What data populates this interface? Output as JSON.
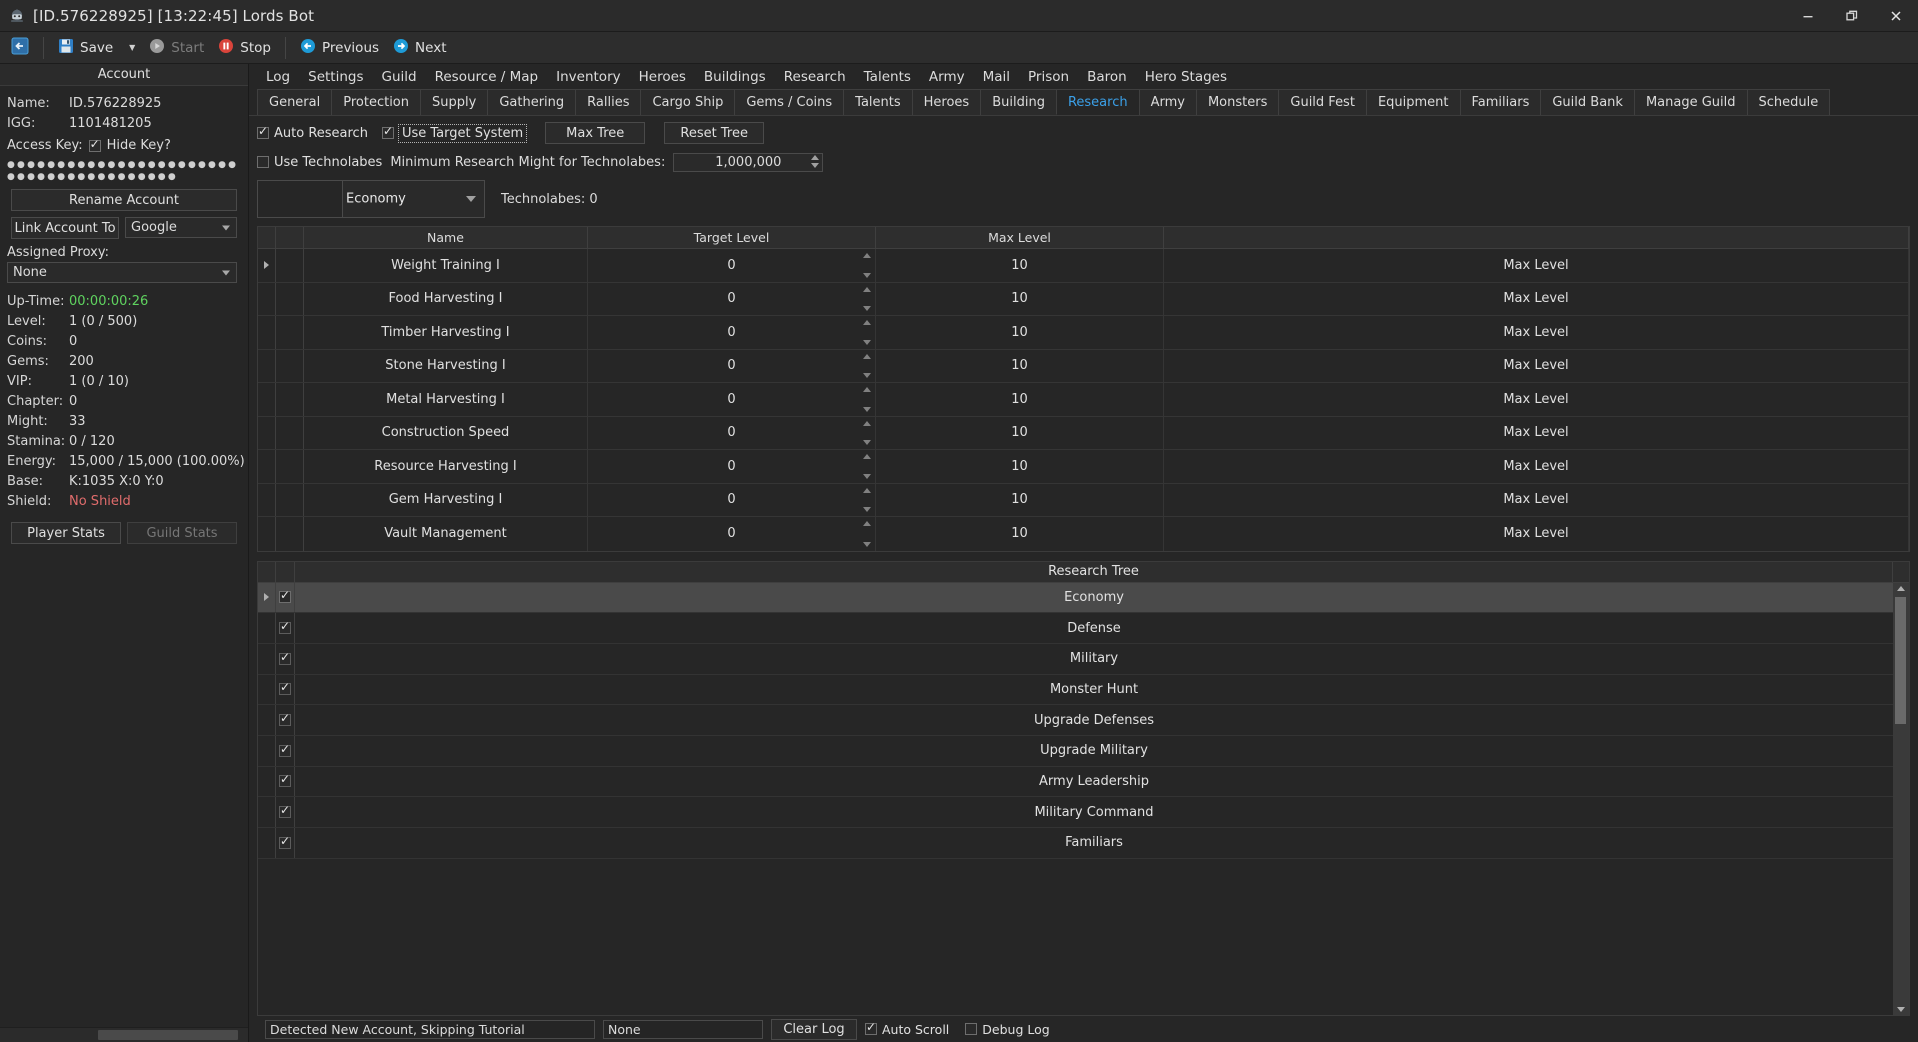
{
  "window": {
    "title": "[ID.576228925] [13:22:45] Lords Bot",
    "app_icon": "bot-icon",
    "minimize": "—",
    "maximize": "❐",
    "close": "✕"
  },
  "toolbar": {
    "back_icon": "back-arrow-icon",
    "save_label": "Save",
    "save_icon": "floppy-disk-icon",
    "save_caret": "▼",
    "start_label": "Start",
    "start_icon": "play-icon",
    "stop_label": "Stop",
    "stop_icon": "pause-icon",
    "previous_label": "Previous",
    "previous_icon": "left-arrow-icon",
    "next_label": "Next",
    "next_icon": "right-arrow-icon"
  },
  "sidebar": {
    "header": "Account",
    "name_label": "Name:",
    "name_value": "ID.576228925",
    "igg_label": "IGG:",
    "igg_value": "1101481205",
    "access_key_label": "Access Key:",
    "hide_key_label": "Hide Key?",
    "hide_key_checked": true,
    "masked_key": "●●●●●●●●●●●●●●●●●●●●●●●●●●●●●●●●●●●●●●●●",
    "rename_account_label": "Rename Account",
    "link_account_label": "Link Account To",
    "link_provider": "Google",
    "assigned_proxy_label": "Assigned Proxy:",
    "assigned_proxy_value": "None",
    "stats": [
      {
        "label": "Up-Time:",
        "value": "00:00:00:26",
        "color": "green"
      },
      {
        "label": "Level:",
        "value": "1  (0 / 500)",
        "color": ""
      },
      {
        "label": "Coins:",
        "value": "0",
        "color": ""
      },
      {
        "label": "Gems:",
        "value": "200",
        "color": ""
      },
      {
        "label": "VIP:",
        "value": "1  (0 / 10)",
        "color": ""
      },
      {
        "label": "Chapter:",
        "value": "0",
        "color": ""
      },
      {
        "label": "Might:",
        "value": "33",
        "color": ""
      },
      {
        "label": "Stamina:",
        "value": "0 / 120",
        "color": ""
      },
      {
        "label": "Energy:",
        "value": "15,000 / 15,000 (100.00%)",
        "color": ""
      },
      {
        "label": "Base:",
        "value": "K:1035 X:0 Y:0",
        "color": ""
      },
      {
        "label": "Shield:",
        "value": "No Shield",
        "color": "red"
      }
    ],
    "player_stats_label": "Player Stats",
    "guild_stats_label": "Guild Stats"
  },
  "menubar": {
    "items": [
      "Log",
      "Settings",
      "Guild",
      "Resource / Map",
      "Inventory",
      "Heroes",
      "Buildings",
      "Research",
      "Talents",
      "Army",
      "Mail",
      "Prison",
      "Baron",
      "Hero Stages"
    ]
  },
  "tabs": {
    "active": "Research",
    "items": [
      "General",
      "Protection",
      "Supply",
      "Gathering",
      "Rallies",
      "Cargo Ship",
      "Gems / Coins",
      "Talents",
      "Heroes",
      "Building",
      "Research",
      "Army",
      "Monsters",
      "Guild Fest",
      "Equipment",
      "Familiars",
      "Guild Bank",
      "Manage Guild",
      "Schedule"
    ]
  },
  "research_panel": {
    "auto_research_label": "Auto Research",
    "auto_research_checked": true,
    "use_target_system_label": "Use Target System",
    "use_target_system_checked": true,
    "max_tree_label": "Max Tree",
    "reset_tree_label": "Reset Tree",
    "use_technolabes_label": "Use Technolabes",
    "use_technolabes_checked": false,
    "min_might_label": "Minimum Research Might for Technolabes:",
    "min_might_value": "1,000,000",
    "category_value": "Economy",
    "technolabes_count_label": "Technolabes: 0"
  },
  "grid": {
    "headers": [
      "",
      "",
      "Name",
      "Target Level",
      "Max Level",
      ""
    ],
    "rows": [
      {
        "name": "Weight Training I",
        "target": "0",
        "max": "10",
        "status": "Max Level"
      },
      {
        "name": "Food Harvesting I",
        "target": "0",
        "max": "10",
        "status": "Max Level"
      },
      {
        "name": "Timber Harvesting I",
        "target": "0",
        "max": "10",
        "status": "Max Level"
      },
      {
        "name": "Stone Harvesting I",
        "target": "0",
        "max": "10",
        "status": "Max Level"
      },
      {
        "name": "Metal Harvesting I",
        "target": "0",
        "max": "10",
        "status": "Max Level"
      },
      {
        "name": "Construction Speed",
        "target": "0",
        "max": "10",
        "status": "Max Level"
      },
      {
        "name": "Resource Harvesting I",
        "target": "0",
        "max": "10",
        "status": "Max Level"
      },
      {
        "name": "Gem Harvesting I",
        "target": "0",
        "max": "10",
        "status": "Max Level"
      },
      {
        "name": "Vault Management",
        "target": "0",
        "max": "10",
        "status": "Max Level"
      }
    ]
  },
  "tree": {
    "header": "Research Tree",
    "rows": [
      {
        "name": "Economy",
        "checked": true,
        "selected": true
      },
      {
        "name": "Defense",
        "checked": true,
        "selected": false
      },
      {
        "name": "Military",
        "checked": true,
        "selected": false
      },
      {
        "name": "Monster Hunt",
        "checked": true,
        "selected": false
      },
      {
        "name": "Upgrade Defenses",
        "checked": true,
        "selected": false
      },
      {
        "name": "Upgrade Military",
        "checked": true,
        "selected": false
      },
      {
        "name": "Army Leadership",
        "checked": true,
        "selected": false
      },
      {
        "name": "Military Command",
        "checked": true,
        "selected": false
      },
      {
        "name": "Familiars",
        "checked": true,
        "selected": false
      }
    ]
  },
  "statusbar": {
    "log_message": "Detected New Account, Skipping Tutorial",
    "secondary_value": "None",
    "clear_log_label": "Clear Log",
    "auto_scroll_label": "Auto Scroll",
    "auto_scroll_checked": true,
    "debug_log_label": "Debug Log",
    "debug_log_checked": false
  },
  "colors": {
    "accent": "#3ba0e8",
    "uptime_green": "#5fd35f",
    "shield_red": "#e06c6c",
    "stop_red": "#d9443b",
    "selection": "#4a4a4a"
  }
}
